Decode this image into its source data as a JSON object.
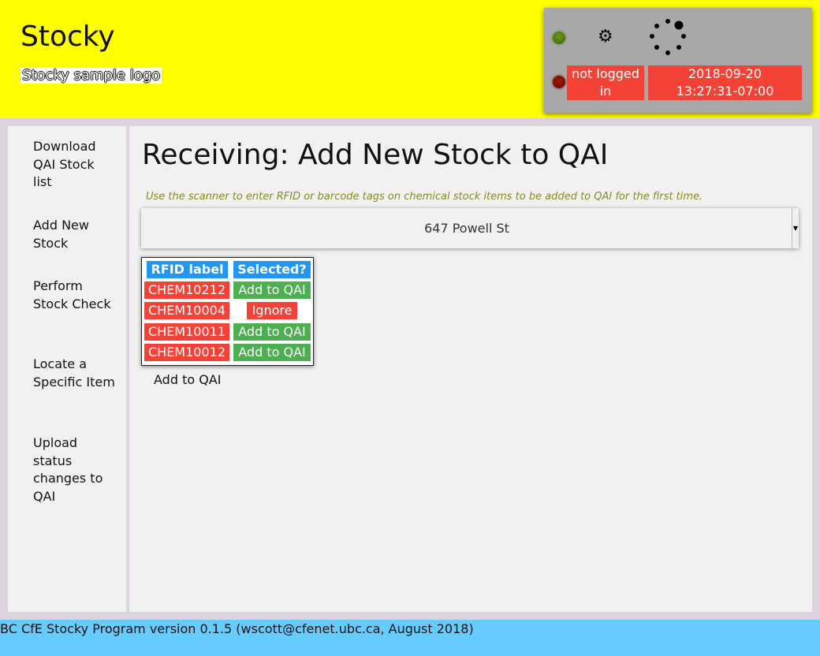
{
  "header": {
    "app_title": "Stocky",
    "logo_text": "Stocky sample logo"
  },
  "status": {
    "login_text": "not logged in",
    "date": "2018-09-20",
    "time": "13:27:31-07:00",
    "icons": [
      "green-led-icon",
      "gear-icon",
      "spinner-icon",
      "red-led-icon"
    ],
    "colors": {
      "alert": "#f44336",
      "header_bg": "#ffff00",
      "footer_bg": "#66ccff"
    }
  },
  "sidebar": {
    "items": [
      {
        "label": "Download QAI Stock list"
      },
      {
        "label": "Add New Stock"
      },
      {
        "label": "Perform Stock Check"
      },
      {
        "label": "Locate a Specific Item"
      },
      {
        "label": "Upload status changes to QAI"
      }
    ]
  },
  "main": {
    "title": "Receiving: Add New Stock to QAI",
    "instructions": "Use the scanner to enter RFID or barcode tags on chemical stock items to be added to QAI for the first time.",
    "location": "647 Powell St",
    "table": {
      "headers": [
        "RFID label",
        "Selected?"
      ],
      "rows": [
        {
          "rfid": "CHEM10212",
          "action": "Add to QAI"
        },
        {
          "rfid": "CHEM10004",
          "action": "Ignore"
        },
        {
          "rfid": "CHEM10011",
          "action": "Add to QAI"
        },
        {
          "rfid": "CHEM10012",
          "action": "Add to QAI"
        }
      ]
    },
    "submit_label": "Add to QAI"
  },
  "footer": {
    "text": "BC CfE Stocky Program version 0.1.5 (wscott@cfenet.ubc.ca, August 2018)"
  }
}
